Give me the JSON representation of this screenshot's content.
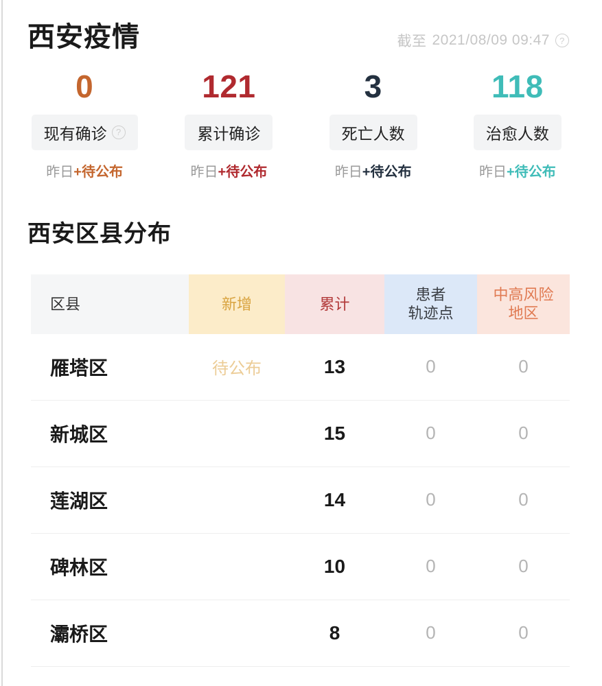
{
  "header": {
    "title": "西安疫情",
    "updated_prefix": "截至",
    "updated_time": "2021/08/09 09:47",
    "help_icon": "?"
  },
  "stats": [
    {
      "value": "0",
      "color": "#c4662e",
      "label": "现有确诊",
      "has_help_icon": true,
      "help_icon": "?",
      "sub_prefix": "昨日",
      "sub_delta": "+待公布"
    },
    {
      "value": "121",
      "color": "#b02a2f",
      "label": "累计确诊",
      "has_help_icon": false,
      "help_icon": "",
      "sub_prefix": "昨日",
      "sub_delta": "+待公布"
    },
    {
      "value": "3",
      "color": "#243140",
      "label": "死亡人数",
      "has_help_icon": false,
      "help_icon": "",
      "sub_prefix": "昨日",
      "sub_delta": "+待公布"
    },
    {
      "value": "118",
      "color": "#3fbcb8",
      "label": "治愈人数",
      "has_help_icon": false,
      "help_icon": "",
      "sub_prefix": "昨日",
      "sub_delta": "+待公布"
    }
  ],
  "section": {
    "title": "西安区县分布"
  },
  "table": {
    "headers": {
      "region": "区县",
      "new": "新增",
      "total": "累计",
      "track_line1": "患者",
      "track_line2": "轨迹点",
      "risk_line1": "中高风险",
      "risk_line2": "地区"
    },
    "rows": [
      {
        "region": "雁塔区",
        "new": "待公布",
        "total": "13",
        "track": "0",
        "risk": "0"
      },
      {
        "region": "新城区",
        "new": "",
        "total": "15",
        "track": "0",
        "risk": "0"
      },
      {
        "region": "莲湖区",
        "new": "",
        "total": "14",
        "track": "0",
        "risk": "0"
      },
      {
        "region": "碑林区",
        "new": "",
        "total": "10",
        "track": "0",
        "risk": "0"
      },
      {
        "region": "灞桥区",
        "new": "",
        "total": "8",
        "track": "0",
        "risk": "0"
      }
    ]
  }
}
